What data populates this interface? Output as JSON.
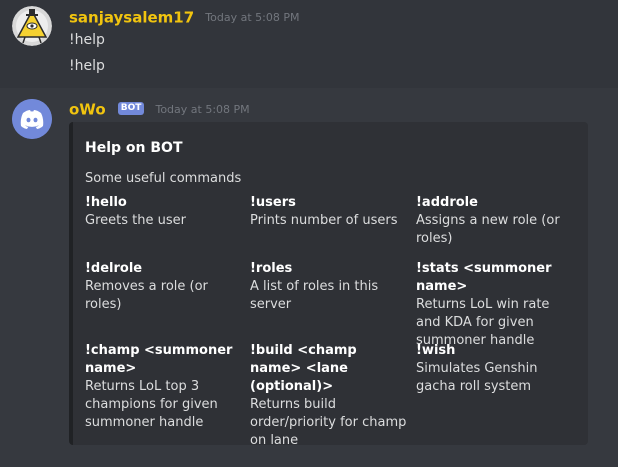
{
  "messages": [
    {
      "username": "sanjaysalem17",
      "timestamp": "Today at 5:08 PM",
      "lines": [
        "!help",
        "!help"
      ]
    },
    {
      "username": "oWo",
      "badge": "BOT",
      "timestamp": "Today at 5:08 PM",
      "embed": {
        "title": "Help on BOT",
        "description": "Some useful commands",
        "fields": [
          {
            "name": "!hello",
            "value": "Greets the user"
          },
          {
            "name": "!users",
            "value": "Prints number of users"
          },
          {
            "name": "!addrole",
            "value": "Assigns a new role (or roles)"
          },
          {
            "name": "!delrole",
            "value": "Removes a role (or roles)"
          },
          {
            "name": "!roles",
            "value": "A list of roles in this server"
          },
          {
            "name": "!stats <summoner name>",
            "value": "Returns LoL win rate and KDA for given summoner handle"
          },
          {
            "name": "!champ <summoner name>",
            "value": "Returns LoL top 3 champions for given summoner handle"
          },
          {
            "name": "!build <champ name> <lane (optional)>",
            "value": "Returns build order/priority for champ on lane"
          },
          {
            "name": "!wish",
            "value": "Simulates Genshin gacha roll system"
          }
        ]
      }
    }
  ],
  "icons": {
    "user_avatar": "illuminati-triangle-avatar-icon",
    "bot_avatar": "discord-logo-avatar-icon"
  },
  "colors": {
    "background": "#36393f",
    "username": "#f1c40f",
    "bot_badge": "#7289da",
    "embed_background": "#2f3136"
  }
}
